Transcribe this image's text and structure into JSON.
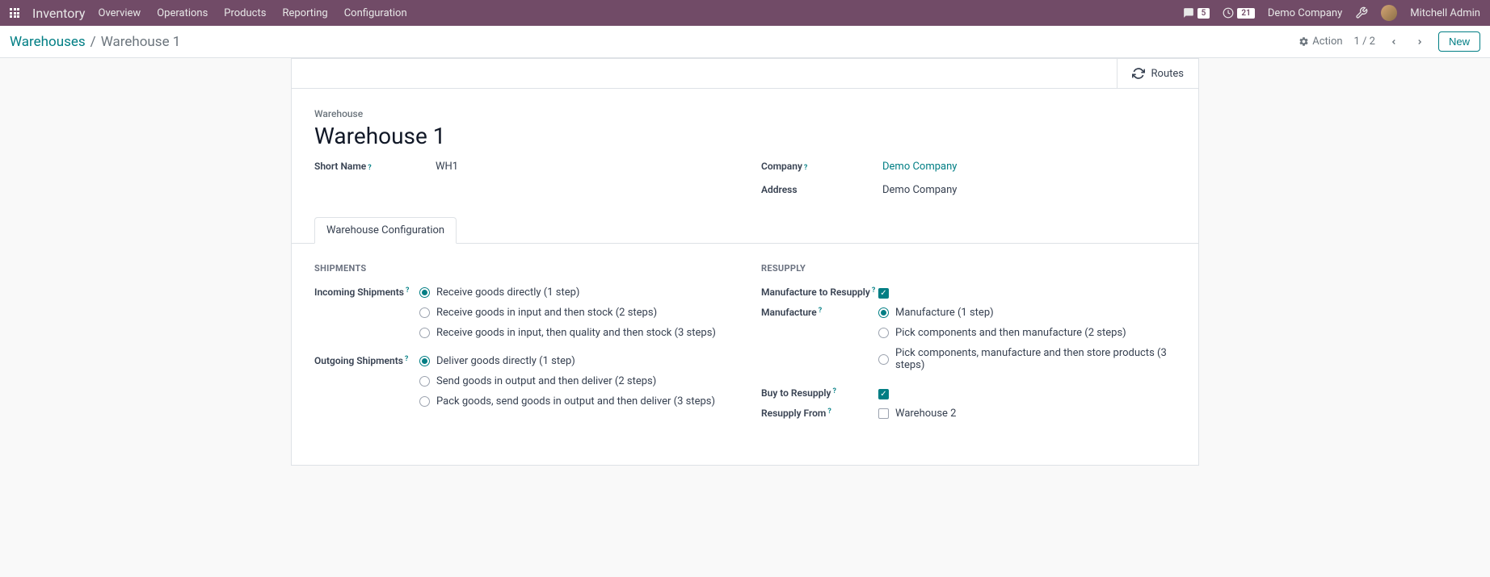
{
  "nav": {
    "brand": "Inventory",
    "menu": [
      "Overview",
      "Operations",
      "Products",
      "Reporting",
      "Configuration"
    ],
    "messages_count": "5",
    "activities_count": "21",
    "company": "Demo Company",
    "user": "Mitchell Admin"
  },
  "breadcrumb": {
    "parent": "Warehouses",
    "current": "Warehouse 1"
  },
  "controls": {
    "action_label": "Action",
    "pager": "1 / 2",
    "new_label": "New"
  },
  "stat": {
    "routes_label": "Routes"
  },
  "form": {
    "warehouse_label": "Warehouse",
    "name": "Warehouse 1",
    "short_name_label": "Short Name",
    "short_name_value": "WH1",
    "company_label": "Company",
    "company_value": "Demo Company",
    "address_label": "Address",
    "address_value": "Demo Company"
  },
  "tab": {
    "label": "Warehouse Configuration"
  },
  "shipments": {
    "heading": "Shipments",
    "incoming_label": "Incoming Shipments",
    "incoming_options": [
      "Receive goods directly (1 step)",
      "Receive goods in input and then stock (2 steps)",
      "Receive goods in input, then quality and then stock (3 steps)"
    ],
    "outgoing_label": "Outgoing Shipments",
    "outgoing_options": [
      "Deliver goods directly (1 step)",
      "Send goods in output and then deliver (2 steps)",
      "Pack goods, send goods in output and then deliver (3 steps)"
    ]
  },
  "resupply": {
    "heading": "Resupply",
    "manufacture_to_resupply_label": "Manufacture to Resupply",
    "manufacture_label": "Manufacture",
    "manufacture_options": [
      "Manufacture (1 step)",
      "Pick components and then manufacture (2 steps)",
      "Pick components, manufacture and then store products (3 steps)"
    ],
    "buy_to_resupply_label": "Buy to Resupply",
    "resupply_from_label": "Resupply From",
    "resupply_from_option": "Warehouse 2"
  }
}
